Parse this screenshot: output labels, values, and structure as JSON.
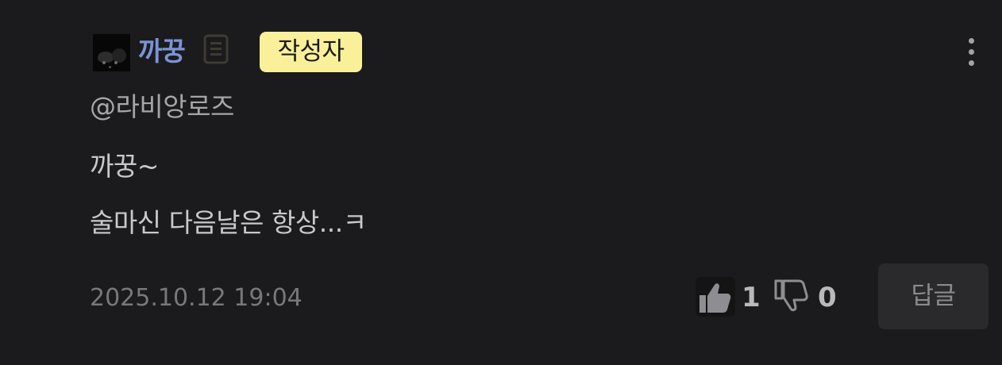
{
  "comment": {
    "author": {
      "name": "까꿍",
      "badge": "작성자",
      "avatar": "avatar-image",
      "memo_icon": "memo-icon"
    },
    "mention": "@라비앙로즈",
    "body_lines": [
      "까꿍~",
      "술마신 다음날은 항상...ㅋ"
    ],
    "timestamp": "2025.10.12 19:04",
    "reactions": {
      "like_icon": "thumbs-up-icon",
      "like_count": "1",
      "dislike_icon": "thumbs-down-icon",
      "dislike_count": "0"
    },
    "reply_label": "답글",
    "more_icon": "more-vertical-icon"
  },
  "colors": {
    "background": "#1b1b1d",
    "author_name": "#7b93d6",
    "badge_bg": "#fbf09a",
    "reply_button_bg": "#2a2a2d"
  }
}
